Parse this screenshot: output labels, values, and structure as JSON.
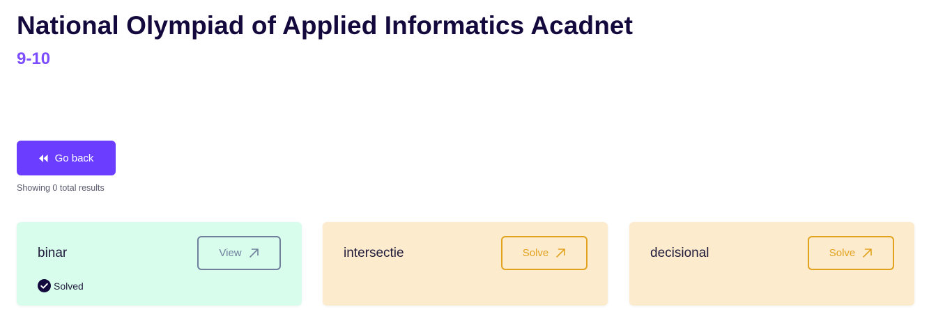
{
  "header": {
    "title": "National Olympiad of Applied Informatics Acadnet",
    "grade": "9-10"
  },
  "toolbar": {
    "go_back_label": "Go back",
    "results_text": "Showing 0 total results"
  },
  "problems": [
    {
      "name": "binar",
      "action_label": "View",
      "status": "Solved"
    },
    {
      "name": "intersectie",
      "action_label": "Solve"
    },
    {
      "name": "decisional",
      "action_label": "Solve"
    }
  ],
  "colors": {
    "primary": "#6a3dff",
    "title": "#14093d",
    "subtitle": "#7c4dff",
    "solved_bg": "#d8fdec",
    "unsolved_bg": "#fcebcd",
    "view_border": "#6f7f9c",
    "solve_border": "#e3a21d"
  },
  "icons": {
    "go_back": "rewind-icon",
    "action": "arrow-up-right-icon",
    "solved": "check-circle-icon"
  }
}
